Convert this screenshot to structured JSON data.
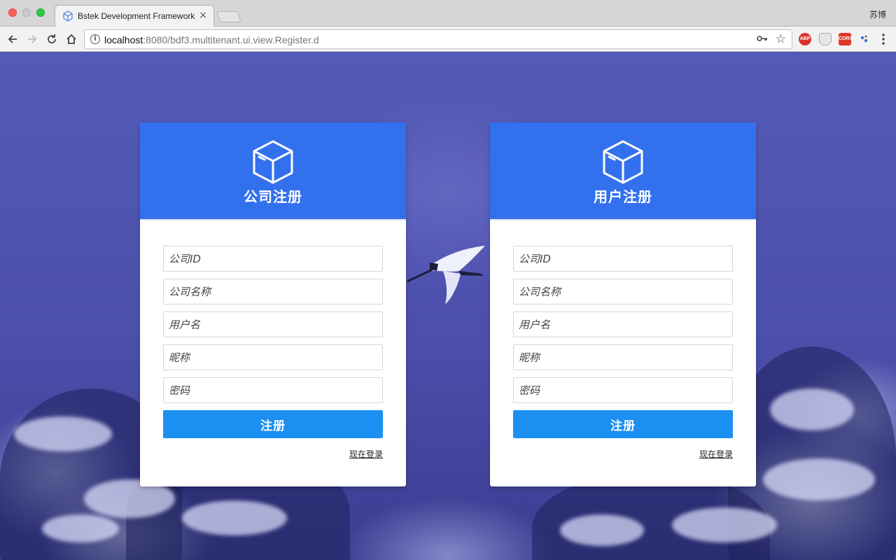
{
  "browser": {
    "tab_title": "Bstek Development Framework",
    "tab_close": "×",
    "profile_name": "苏博",
    "url_host": "localhost",
    "url_rest": ":8080/bdf3.multitenant.ui.view.Register.d",
    "extensions": [
      "ABP",
      "CORS"
    ]
  },
  "company_register": {
    "title": "公司注册",
    "fields": [
      {
        "placeholder": "公司ID"
      },
      {
        "placeholder": "公司名称"
      },
      {
        "placeholder": "用户名"
      },
      {
        "placeholder": "昵称"
      },
      {
        "placeholder": "密码"
      }
    ],
    "submit_label": "注册",
    "login_link": "现在登录"
  },
  "user_register": {
    "title": "用户注册",
    "fields": [
      {
        "placeholder": "公司ID"
      },
      {
        "placeholder": "公司名称"
      },
      {
        "placeholder": "用户名"
      },
      {
        "placeholder": "昵称"
      },
      {
        "placeholder": "密码"
      }
    ],
    "submit_label": "注册",
    "login_link": "现在登录"
  },
  "colors": {
    "header_blue": "#3370ee",
    "button_blue": "#1b8ff2",
    "background": "#4a4ea6"
  },
  "icons": {
    "card_header": "box-icon",
    "tab_favicon": "cube-icon"
  }
}
